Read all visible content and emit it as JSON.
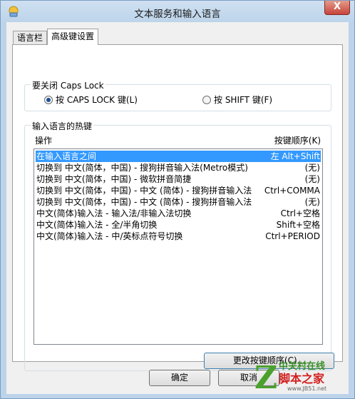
{
  "window": {
    "title": "文本服务和输入语言",
    "close_glyph": "X"
  },
  "tabs": [
    {
      "label": "语言栏",
      "active": false
    },
    {
      "label": "高级键设置",
      "active": true
    }
  ],
  "caps_lock": {
    "title": "要关闭 Caps Lock",
    "options": [
      {
        "label": "按 CAPS LOCK 键(L)",
        "selected": true
      },
      {
        "label": "按 SHIFT 键(F)",
        "selected": false
      }
    ]
  },
  "hotkeys": {
    "title": "输入语言的热键",
    "col_action": "操作",
    "col_sequence": "按键顺序(K)",
    "rows": [
      {
        "action": "在输入语言之间",
        "keys": "左 Alt+Shift",
        "selected": true
      },
      {
        "action": "切换到 中文(简体，中国) - 搜狗拼音输入法(Metro模式)",
        "keys": "(无)",
        "selected": false
      },
      {
        "action": "切换到 中文(简体，中国) - 微软拼音简捷",
        "keys": "(无)",
        "selected": false
      },
      {
        "action": "切换到 中文(简体，中国) - 中文 (简体) - 搜狗拼音输入法",
        "keys": "Ctrl+COMMA",
        "selected": false
      },
      {
        "action": "切换到 中文(简体，中国) - 中文 (简体) - 搜狗拼音输入法",
        "keys": "(无)",
        "selected": false
      },
      {
        "action": "中文(简体)输入法 - 输入法/非输入法切换",
        "keys": "Ctrl+空格",
        "selected": false
      },
      {
        "action": "中文(简体)输入法 - 全/半角切换",
        "keys": "Shift+空格",
        "selected": false
      },
      {
        "action": "中文(简体)输入法 - 中/英标点符号切换",
        "keys": "Ctrl+PERIOD",
        "selected": false
      }
    ],
    "change_button": "更改按键顺序(C)..."
  },
  "buttons": {
    "ok": "确定",
    "cancel": "取消"
  },
  "watermark": {
    "line1": "中关村在线",
    "line2": "脚本之家",
    "line3": "www.JB51.net",
    "logo_letter": "Z"
  },
  "colors": {
    "selection": "#3399ff",
    "title_bar": "#bcd3ea",
    "close_button": "#c7443b"
  }
}
